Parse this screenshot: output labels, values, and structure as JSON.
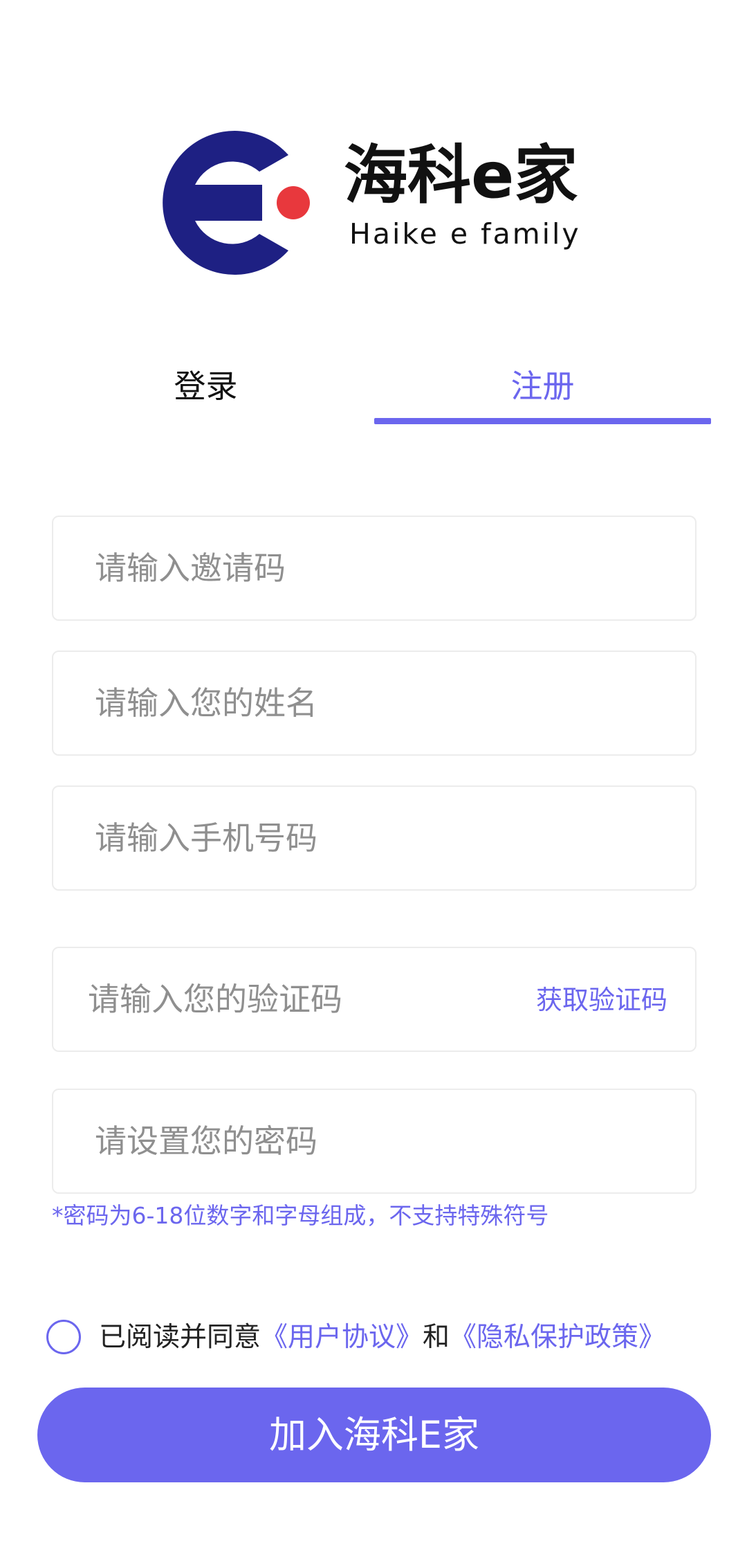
{
  "logo": {
    "title": "海科e家",
    "subtitle": "Haike e family",
    "mark_color": "#1e2083",
    "dot_color": "#e8383d"
  },
  "tabs": {
    "login": "登录",
    "register": "注册",
    "active": "register"
  },
  "form": {
    "invite_code_placeholder": "请输入邀请码",
    "name_placeholder": "请输入您的姓名",
    "phone_placeholder": "请输入手机号码",
    "verify_code_placeholder": "请输入您的验证码",
    "get_code_label": "获取验证码",
    "password_placeholder": "请设置您的密码",
    "password_hint": "*密码为6-18位数字和字母组成，不支持特殊符号"
  },
  "agreement": {
    "prefix": "已阅读并同意",
    "user_agreement": "《用户协议》",
    "and": "和",
    "privacy_policy": "《隐私保护政策》",
    "checked": false
  },
  "submit_label": "加入海科E家",
  "colors": {
    "accent": "#6b66ee",
    "text": "#111111",
    "placeholder": "#8f8f8f",
    "border": "#ececec"
  }
}
